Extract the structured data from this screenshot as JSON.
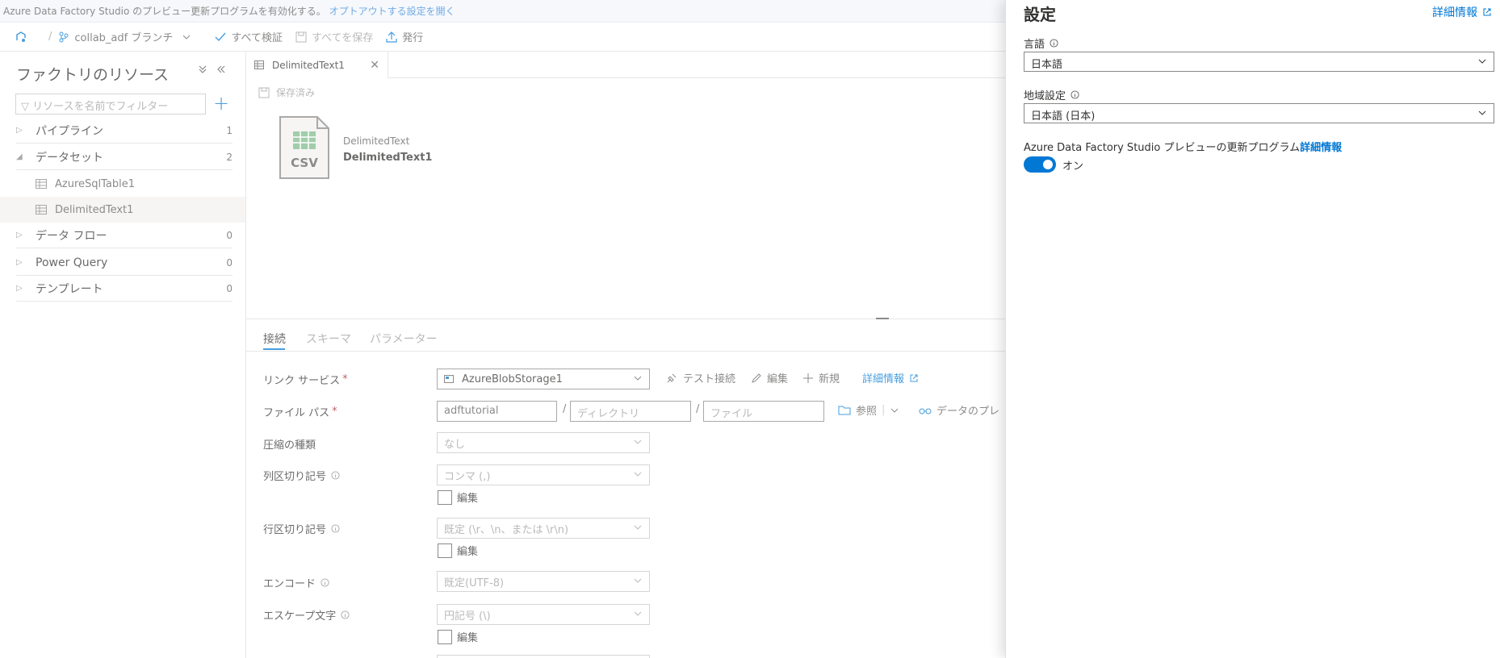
{
  "banner": {
    "text": "Azure Data Factory Studio のプレビュー更新プログラムを有効化する。",
    "optout_prefix": "オプトアウトする",
    "settings_link": "設定を開く"
  },
  "toolbar": {
    "sep": "/",
    "branch": "collab_adf ブランチ",
    "validate_all": "すべて検証",
    "save_all": "すべてを保存",
    "publish": "発行"
  },
  "sidebar": {
    "title": "ファクトリのリソース",
    "filter_placeholder": "リソースを名前でフィルター",
    "items": [
      {
        "label": "パイプライン",
        "count": "1"
      },
      {
        "label": "データセット",
        "count": "2"
      },
      {
        "label": "データ フロー",
        "count": "0"
      },
      {
        "label": "Power Query",
        "count": "0"
      },
      {
        "label": "テンプレート",
        "count": "0"
      }
    ],
    "datasets": [
      "AzureSqlTable1",
      "DelimitedText1"
    ]
  },
  "editor": {
    "tab_label": "DelimitedText1",
    "saved_label": "保存済み",
    "icon_text": "CSV",
    "dataset_type": "DelimitedText",
    "dataset_name": "DelimitedText1"
  },
  "props": {
    "tabs": [
      "接続",
      "スキーマ",
      "パラメーター"
    ],
    "linked_service": {
      "label": "リンク サービス",
      "value": "AzureBlobStorage1"
    },
    "actions": {
      "test": "テスト接続",
      "edit": "編集",
      "new": "新規",
      "more": "詳細情報"
    },
    "file_path": {
      "label": "ファイル パス",
      "container": "adftutorial",
      "dir_placeholder": "ディレクトリ",
      "file_placeholder": "ファイル",
      "browse": "参照",
      "preview": "データのプレ",
      "sep": "/"
    },
    "compression": {
      "label": "圧縮の種類",
      "value": "なし"
    },
    "column_delim": {
      "label": "列区切り記号",
      "value": "コンマ (,)"
    },
    "row_delim": {
      "label": "行区切り記号",
      "value": "既定 (\\r、\\n、または \\r\\n)"
    },
    "encoding": {
      "label": "エンコード",
      "value": "既定(UTF-8)"
    },
    "escape": {
      "label": "エスケープ文字",
      "value": "円記号 (\\)"
    },
    "edit_label": "編集",
    "required_mark": "*"
  },
  "settings": {
    "title": "設定",
    "more_info": "詳細情報",
    "language_label": "言語",
    "language_value": "日本語",
    "region_label": "地域設定",
    "region_value": "日本語 (日本)",
    "preview_label": "Azure Data Factory Studio プレビューの更新プログラム",
    "preview_link": "詳細情報",
    "toggle_label": "オン",
    "toggle_on": true
  },
  "colors": {
    "accent": "#0078d4",
    "banner_bg": "#f3f6fb"
  }
}
